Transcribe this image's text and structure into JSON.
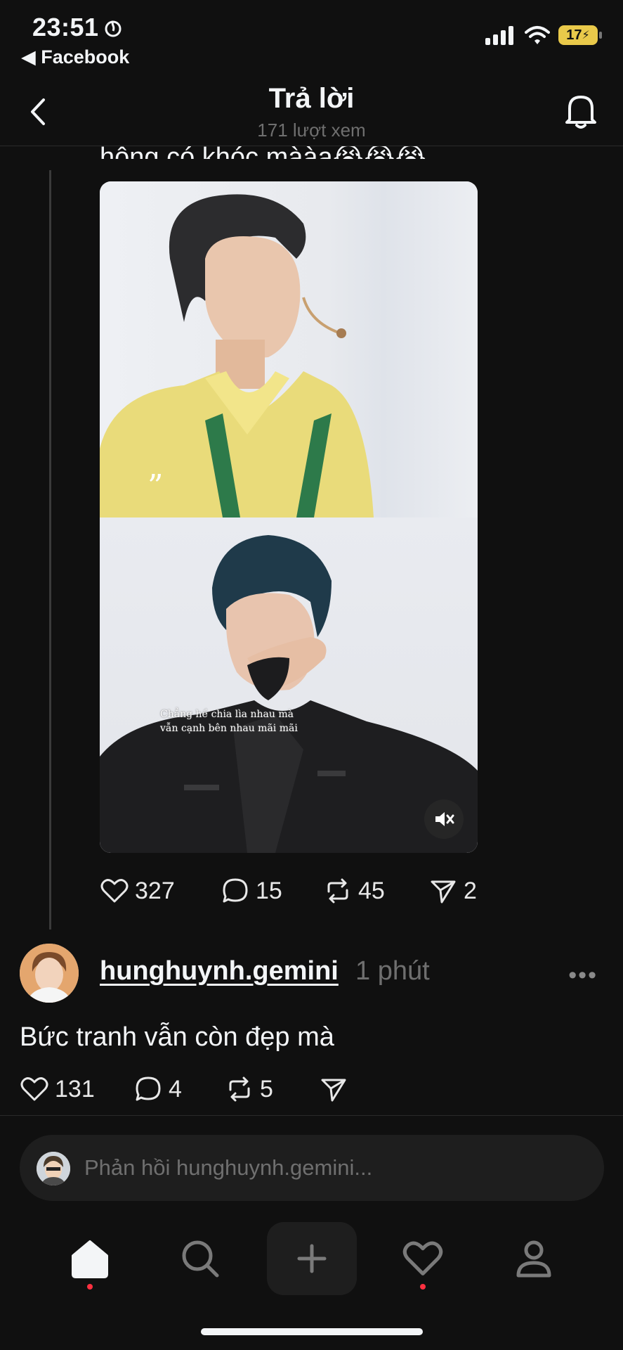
{
  "status_bar": {
    "time": "23:51",
    "back_app": "◀ Facebook",
    "battery": "17"
  },
  "header": {
    "title": "Trả lời",
    "views": "171 lượt xem"
  },
  "post": {
    "cut_text": "hông có khóc mààa😭😭😭",
    "caption_line1": "Chẳng hề chia lìa nhau mà",
    "caption_line2": "vẫn cạnh bên nhau mãi mãi",
    "likes": "327",
    "comments": "15",
    "reposts": "45",
    "shares": "2"
  },
  "reply": {
    "username": "hunghuynh.gemini",
    "time": "1 phút",
    "more": "•••",
    "text": "Bức tranh vẫn còn đẹp mà",
    "likes": "131",
    "comments": "4",
    "reposts": "5"
  },
  "composer": {
    "placeholder": "Phản hồi hunghuynh.gemini..."
  },
  "colors": {
    "background": "#101010",
    "text": "#f3f5f7",
    "muted": "#6f6f6f",
    "notification_dot": "#ff3040",
    "battery": "#e9c94a"
  },
  "icons": [
    "back-chevron-icon",
    "bell-icon",
    "heart-icon",
    "comment-icon",
    "repost-icon",
    "send-icon",
    "mute-icon",
    "home-icon",
    "search-icon",
    "plus-icon",
    "profile-icon"
  ]
}
